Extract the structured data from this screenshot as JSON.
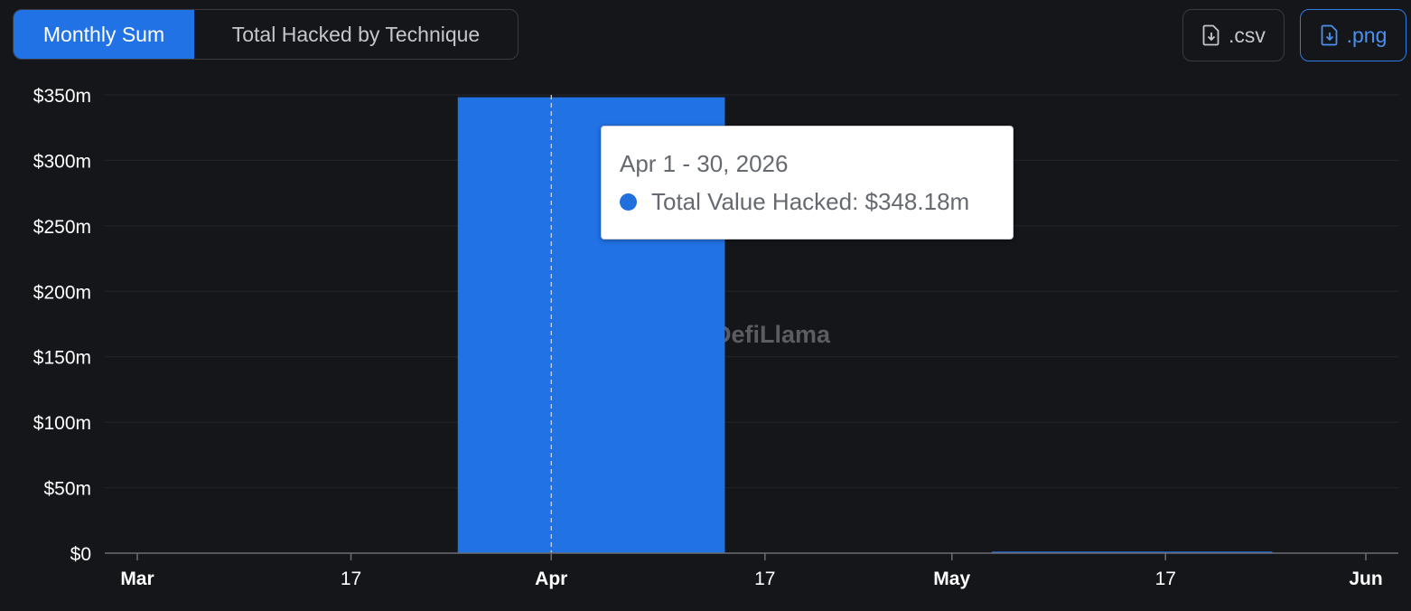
{
  "toolbar": {
    "tabs": [
      {
        "label": "Monthly Sum",
        "active": true
      },
      {
        "label": "Total Hacked by Technique",
        "active": false
      }
    ],
    "csv_label": ".csv",
    "png_label": ".png",
    "download_icon": "file-download-icon"
  },
  "colors": {
    "background": "#151619",
    "bar": "#2172e5",
    "accent": "#2f7ae5",
    "tooltip_dot": "#1f6fdd"
  },
  "watermark": "DefiLlama",
  "tooltip": {
    "title": "Apr 1 - 30, 2026",
    "series_label": "Total Value Hacked: $348.18m"
  },
  "chart_data": {
    "type": "bar",
    "x_ticks": [
      "Mar",
      "17",
      "Apr",
      "17",
      "May",
      "17",
      "Jun"
    ],
    "x_tick_dates": [
      "2026-03-01",
      "2026-03-17",
      "2026-04-01",
      "2026-04-17",
      "2026-05-01",
      "2026-05-17",
      "2026-06-01"
    ],
    "y_ticks": [
      "$0",
      "$50m",
      "$100m",
      "$150m",
      "$200m",
      "$250m",
      "$300m",
      "$350m"
    ],
    "ylim": [
      0,
      350
    ],
    "series": [
      {
        "name": "Total Value Hacked",
        "points": [
          {
            "month": "2026-04",
            "start": "2026-03-25",
            "end": "2026-04-14",
            "value": 348.18
          },
          {
            "month": "2026-05",
            "start": "2026-05-04",
            "end": "2026-05-25",
            "value": 1.2
          }
        ]
      }
    ],
    "hover_date": "2026-04-01",
    "grid": true
  }
}
